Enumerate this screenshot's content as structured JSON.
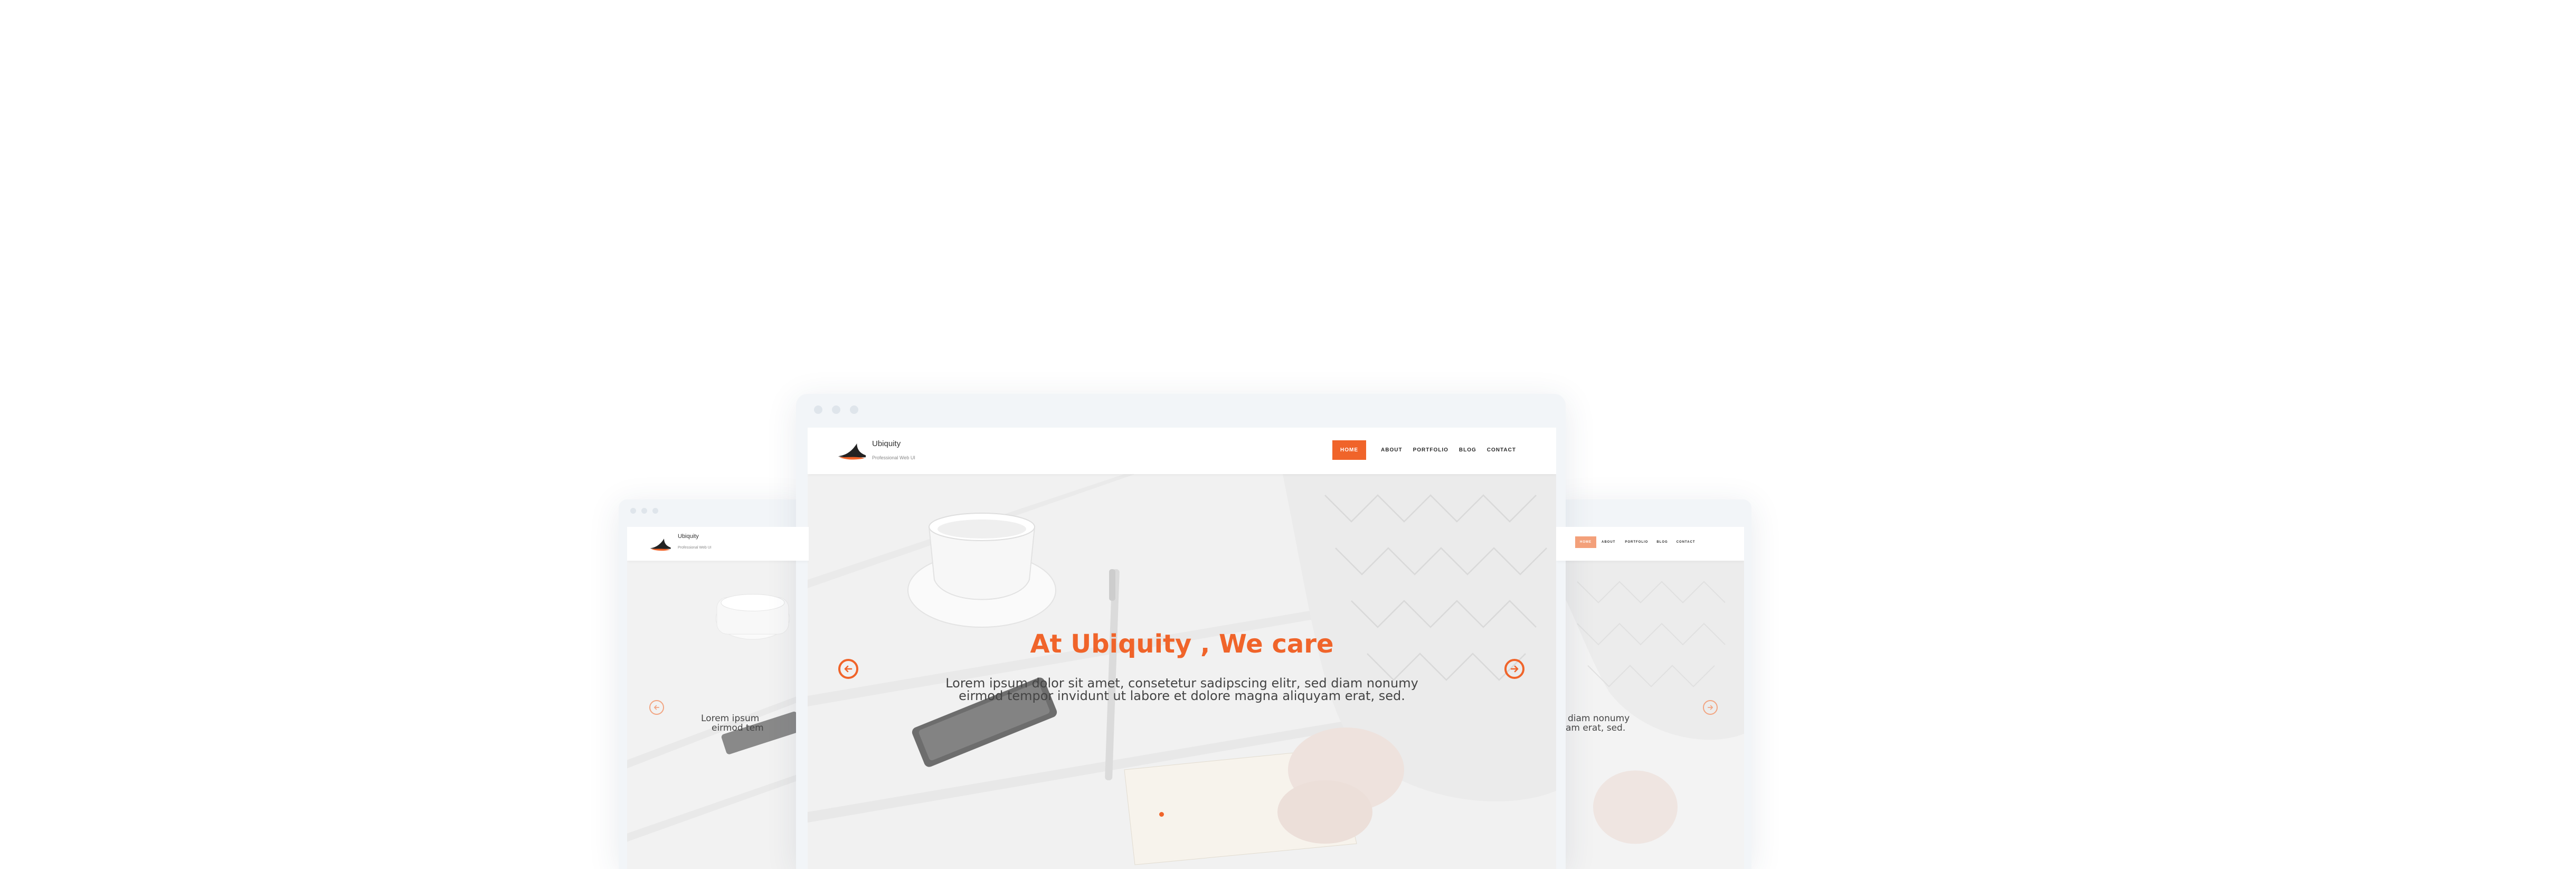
{
  "theme": {
    "accent": "#f0642a",
    "nav_text": "#2a2a2a"
  },
  "site": {
    "brand_name": "Ubiquity",
    "brand_tagline": "Professional Web UI",
    "logo_icon": "bird-wing-logo-icon",
    "nav": [
      {
        "label": "HOME",
        "active": true
      },
      {
        "label": "ABOUT",
        "active": false
      },
      {
        "label": "PORTFOLIO",
        "active": false
      },
      {
        "label": "BLOG",
        "active": false
      },
      {
        "label": "CONTACT",
        "active": false
      }
    ]
  },
  "hero": {
    "title": "At Ubiquity , We care",
    "subtitle_line1": "Lorem ipsum dolor sit amet, consetetur sadipscing elitr, sed diam nonumy",
    "subtitle_line2": "eirmod tempor invidunt ut labore et dolore magna aliquyam erat, sed.",
    "prev_icon": "arrow-left-circle-icon",
    "next_icon": "arrow-right-circle-icon"
  },
  "left_window": {
    "subtitle_fragment1": "Lorem ipsum",
    "subtitle_fragment2": "eirmod tem"
  },
  "right_window": {
    "subtitle_fragment1": "diam nonumy",
    "subtitle_fragment2": "am erat, sed."
  }
}
